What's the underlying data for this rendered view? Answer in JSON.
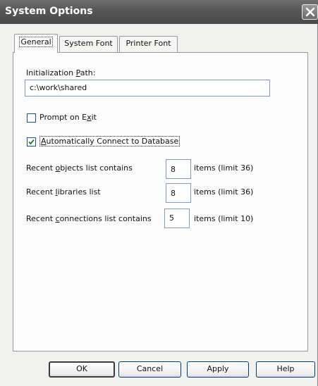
{
  "window": {
    "title": "System Options"
  },
  "tabs": [
    {
      "label": "General",
      "active": true
    },
    {
      "label": "System Font",
      "active": false
    },
    {
      "label": "Printer Font",
      "active": false
    }
  ],
  "general": {
    "init_path_label_pre": "Initialization ",
    "init_path_label_key": "P",
    "init_path_label_post": "ath:",
    "init_path_value": "c:\\work\\shared",
    "prompt_exit_pre": "Prompt on E",
    "prompt_exit_key": "x",
    "prompt_exit_post": "it",
    "prompt_exit_checked": false,
    "auto_connect_pre": "",
    "auto_connect_key": "A",
    "auto_connect_post": "utomatically Connect to Database",
    "auto_connect_checked": true,
    "recent_objects_pre": "Recent ",
    "recent_objects_key": "o",
    "recent_objects_post": "bjects list contains",
    "recent_objects_value": "8",
    "recent_objects_suffix": "items (limit 36)",
    "recent_libraries_pre": "Recent ",
    "recent_libraries_key": "l",
    "recent_libraries_post": "ibraries list",
    "recent_libraries_value": "8",
    "recent_libraries_suffix": "items (limit 36)",
    "recent_connections_pre": "Recent ",
    "recent_connections_key": "c",
    "recent_connections_post": "onnections list contains",
    "recent_connections_value": "5",
    "recent_connections_suffix": "items (limit 10)"
  },
  "buttons": {
    "ok": "OK",
    "cancel": "Cancel",
    "apply": "Apply",
    "help": "Help"
  }
}
